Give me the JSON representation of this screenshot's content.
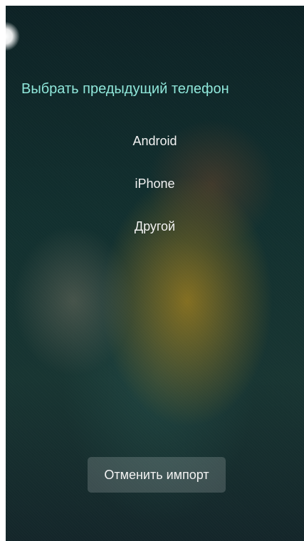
{
  "title": "Выбрать предыдущий телефон",
  "options": [
    "Android",
    "iPhone",
    "Другой"
  ],
  "cancel_label": "Отменить импорт",
  "colors": {
    "accent_title": "#8fe7da",
    "text_primary": "#f2f2f2",
    "background_dark": "#12302f",
    "button_background": "rgba(255,255,255,0.17)"
  }
}
